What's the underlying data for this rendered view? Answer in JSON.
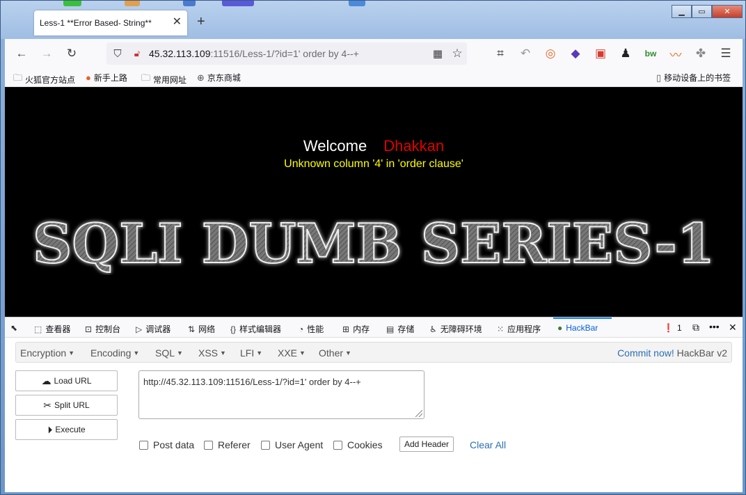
{
  "tab": {
    "title": "Less-1 **Error Based- String**"
  },
  "url": {
    "host": "45.32.113.109",
    "path": ":11516/Less-1/?id=1' order by 4--+"
  },
  "bookmarks": [
    "火狐官方站点",
    "新手上路",
    "常用网址",
    "京东商城"
  ],
  "bookmarks_right": "移动设备上的书签",
  "page": {
    "welcome": "Welcome",
    "name": "Dhakkan",
    "error": "Unknown column '4' in 'order clause'",
    "banner": "SQLI DUMB SERIES-1"
  },
  "devtools": {
    "tabs": [
      "查看器",
      "控制台",
      "调试器",
      "网络",
      "样式编辑器",
      "性能",
      "内存",
      "存储",
      "无障碍环境",
      "应用程序",
      "HackBar"
    ],
    "error_count": "1"
  },
  "hackbar": {
    "menu": [
      "Encryption",
      "Encoding",
      "SQL",
      "XSS",
      "LFI",
      "XXE",
      "Other"
    ],
    "commit_link": "Commit now!",
    "version": "HackBar v2",
    "load_url": "Load URL",
    "split_url": "Split URL",
    "execute": "Execute",
    "url_value": "http://45.32.113.109:11516/Less-1/?id=1' order by 4--+",
    "options": [
      "Post data",
      "Referer",
      "User Agent",
      "Cookies"
    ],
    "add_header": "Add Header",
    "clear_all": "Clear All"
  },
  "colors": {
    "welcome": "#ffffff",
    "name": "#e00000",
    "error": "#ffff00",
    "accent": "#0a84ff"
  }
}
